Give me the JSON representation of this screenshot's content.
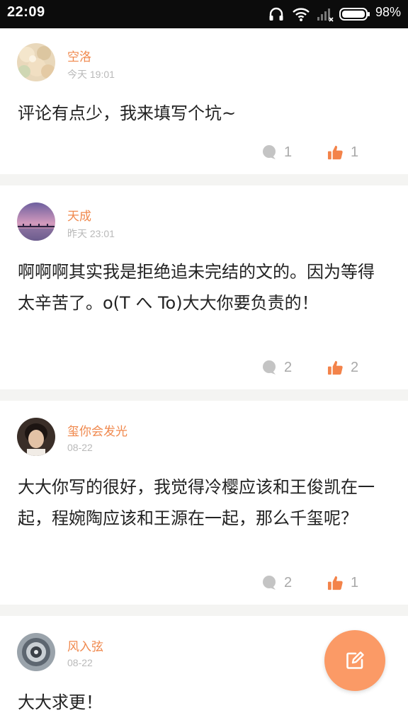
{
  "status_bar": {
    "time": "22:09",
    "battery_percent": "98%",
    "icons": [
      "headphones-icon",
      "wifi-icon",
      "signal-icon",
      "battery-icon"
    ]
  },
  "colors": {
    "accent": "#f0894e",
    "fab": "#fb9a66",
    "date_gray": "#b9b9b9",
    "count_gray": "#a9a9a9"
  },
  "comments": [
    {
      "username": "空洛",
      "date": "今天 19:01",
      "text": "评论有点少，我来填写个坑~",
      "reply_count": "1",
      "like_count": "1"
    },
    {
      "username": "天成",
      "date": "昨天 23:01",
      "text": "啊啊啊其实我是拒绝追未完结的文的。因为等得太辛苦了。o(T へ To)大大你要负责的！",
      "reply_count": "2",
      "like_count": "2"
    },
    {
      "username": "玺你会发光",
      "date": "08-22",
      "text": "大大你写的很好，我觉得冷樱应该和王俊凯在一起，程婉陶应该和王源在一起，那么千玺呢？",
      "reply_count": "2",
      "like_count": "1"
    },
    {
      "username": "风入弦",
      "date": "08-22",
      "text": "大大求更！"
    }
  ],
  "fab": {
    "icon": "edit-icon"
  }
}
